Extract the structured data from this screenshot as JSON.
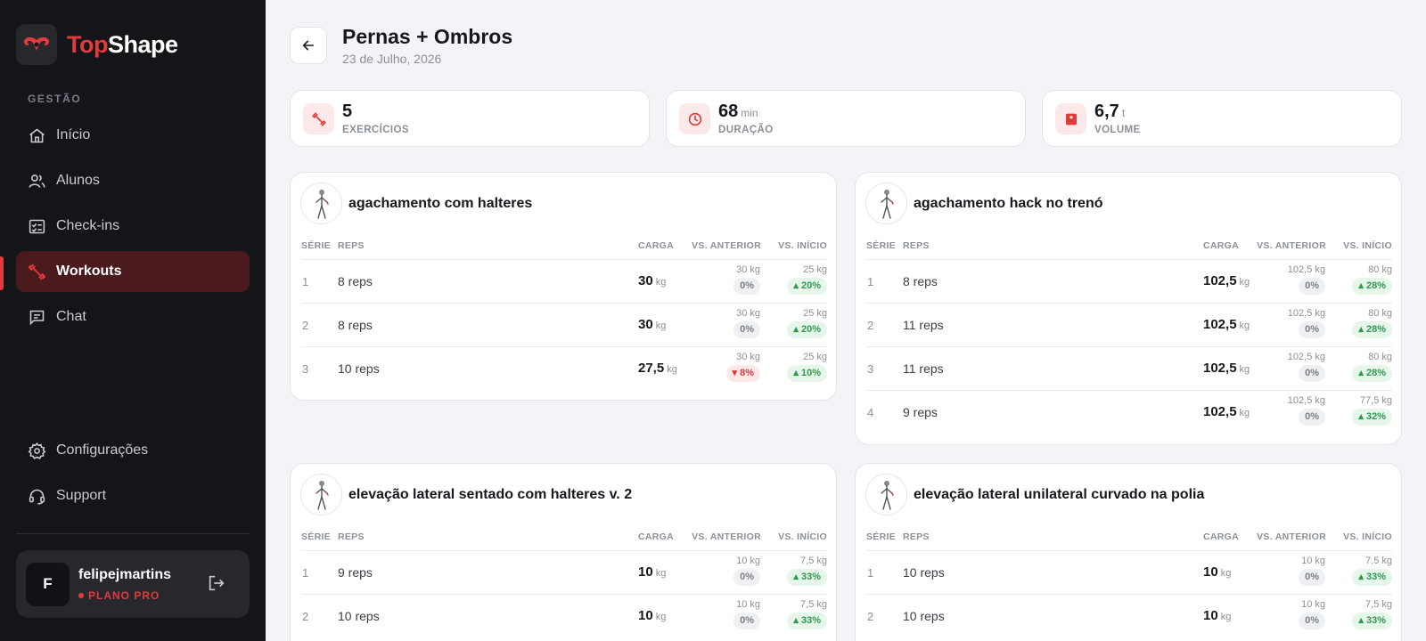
{
  "brand": {
    "top": "Top",
    "shape": "Shape"
  },
  "sidebar": {
    "section_label": "GESTÃO",
    "items": [
      {
        "label": "Início",
        "icon": "home-icon"
      },
      {
        "label": "Alunos",
        "icon": "users-icon"
      },
      {
        "label": "Check-ins",
        "icon": "checklist-icon"
      },
      {
        "label": "Workouts",
        "icon": "dumbbell-icon",
        "active": true
      },
      {
        "label": "Chat",
        "icon": "chat-icon"
      }
    ],
    "bottom_items": [
      {
        "label": "Configurações",
        "icon": "gear-icon"
      },
      {
        "label": "Support",
        "icon": "headset-icon"
      }
    ],
    "user": {
      "initial": "F",
      "name": "felipejmartins",
      "plan": "PLANO PRO"
    }
  },
  "header": {
    "title": "Pernas + Ombros",
    "date": "23 de Julho, 2026"
  },
  "stats": [
    {
      "value": "5",
      "unit": "",
      "label": "EXERCÍCIOS"
    },
    {
      "value": "68",
      "unit": "min",
      "label": "DURAÇÃO"
    },
    {
      "value": "6,7",
      "unit": "t",
      "label": "VOLUME"
    }
  ],
  "table_headers": {
    "serie": "SÉRIE",
    "reps": "REPS",
    "carga": "CARGA",
    "vs_anterior": "VS. ANTERIOR",
    "vs_inicio": "VS. INÍCIO"
  },
  "load_unit": "kg",
  "exercises": [
    {
      "name": "agachamento com halteres",
      "sets": [
        {
          "serie": "1",
          "reps": "8 reps",
          "carga": "30",
          "ant_prev": "30 kg",
          "ant_pct": "0%",
          "ant_dir": "neutral",
          "ini_prev": "25 kg",
          "ini_pct": "20%",
          "ini_dir": "up"
        },
        {
          "serie": "2",
          "reps": "8 reps",
          "carga": "30",
          "ant_prev": "30 kg",
          "ant_pct": "0%",
          "ant_dir": "neutral",
          "ini_prev": "25 kg",
          "ini_pct": "20%",
          "ini_dir": "up"
        },
        {
          "serie": "3",
          "reps": "10 reps",
          "carga": "27,5",
          "ant_prev": "30 kg",
          "ant_pct": "8%",
          "ant_dir": "down",
          "ini_prev": "25 kg",
          "ini_pct": "10%",
          "ini_dir": "up"
        }
      ]
    },
    {
      "name": "agachamento hack no trenó",
      "sets": [
        {
          "serie": "1",
          "reps": "8 reps",
          "carga": "102,5",
          "ant_prev": "102,5 kg",
          "ant_pct": "0%",
          "ant_dir": "neutral",
          "ini_prev": "80 kg",
          "ini_pct": "28%",
          "ini_dir": "up"
        },
        {
          "serie": "2",
          "reps": "11 reps",
          "carga": "102,5",
          "ant_prev": "102,5 kg",
          "ant_pct": "0%",
          "ant_dir": "neutral",
          "ini_prev": "80 kg",
          "ini_pct": "28%",
          "ini_dir": "up"
        },
        {
          "serie": "3",
          "reps": "11 reps",
          "carga": "102,5",
          "ant_prev": "102,5 kg",
          "ant_pct": "0%",
          "ant_dir": "neutral",
          "ini_prev": "80 kg",
          "ini_pct": "28%",
          "ini_dir": "up"
        },
        {
          "serie": "4",
          "reps": "9 reps",
          "carga": "102,5",
          "ant_prev": "102,5 kg",
          "ant_pct": "0%",
          "ant_dir": "neutral",
          "ini_prev": "77,5 kg",
          "ini_pct": "32%",
          "ini_dir": "up"
        }
      ]
    },
    {
      "name": "elevação lateral sentado com halteres v. 2",
      "sets": [
        {
          "serie": "1",
          "reps": "9 reps",
          "carga": "10",
          "ant_prev": "10 kg",
          "ant_pct": "0%",
          "ant_dir": "neutral",
          "ini_prev": "7,5 kg",
          "ini_pct": "33%",
          "ini_dir": "up"
        },
        {
          "serie": "2",
          "reps": "10 reps",
          "carga": "10",
          "ant_prev": "10 kg",
          "ant_pct": "0%",
          "ant_dir": "neutral",
          "ini_prev": "7,5 kg",
          "ini_pct": "33%",
          "ini_dir": "up"
        }
      ]
    },
    {
      "name": "elevação lateral unilateral curvado na polia",
      "sets": [
        {
          "serie": "1",
          "reps": "10 reps",
          "carga": "10",
          "ant_prev": "10 kg",
          "ant_pct": "0%",
          "ant_dir": "neutral",
          "ini_prev": "7,5 kg",
          "ini_pct": "33%",
          "ini_dir": "up"
        },
        {
          "serie": "2",
          "reps": "10 reps",
          "carga": "10",
          "ant_prev": "10 kg",
          "ant_pct": "0%",
          "ant_dir": "neutral",
          "ini_prev": "7,5 kg",
          "ini_pct": "33%",
          "ini_dir": "up"
        }
      ]
    }
  ],
  "colors": {
    "accent": "#e23b3b",
    "sidebar_bg": "#141519",
    "active_bg": "#4a1a1d",
    "up": "#2f9a4f",
    "down": "#d43c3c"
  }
}
